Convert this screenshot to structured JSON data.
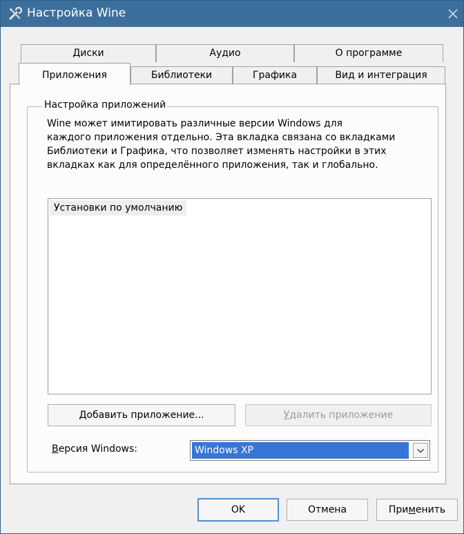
{
  "window": {
    "title": "Настройка Wine",
    "app_icon": "tools-icon",
    "close_icon": "close-icon"
  },
  "tabs": {
    "row1": [
      "Диски",
      "Аудио",
      "О программе"
    ],
    "row2": [
      "Приложения",
      "Библиотеки",
      "Графика",
      "Вид и интеграция"
    ],
    "active": "Приложения"
  },
  "apps": {
    "group_title": "Настройка приложений",
    "description": [
      "Wine может имитировать различные версии Windows для",
      "каждого приложения отдельно. Эта вкладка связана со вкладками",
      "Библиотеки и Графика, что позволяет изменять настройки в этих",
      "вкладках как для определённого приложения, так и глобально."
    ],
    "list_items": [
      "Установки по умолчанию"
    ],
    "add_button": "Добавить приложение...",
    "remove_button": {
      "prefix": "",
      "accel": "У",
      "rest": "далить приложение"
    },
    "winver_label": {
      "accel": "В",
      "rest": "ерсия Windows:"
    },
    "winver_value": "Windows XP"
  },
  "buttons": {
    "ok": "OK",
    "cancel": "Отмена",
    "apply": {
      "prefix": "При",
      "accel": "м",
      "rest": "енить"
    }
  }
}
